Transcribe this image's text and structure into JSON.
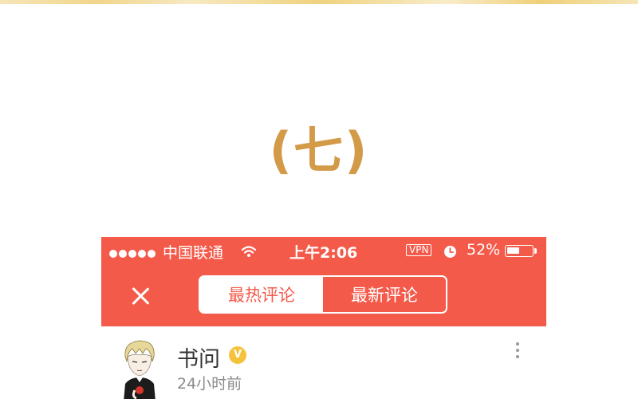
{
  "chapter": {
    "heading": "(七)"
  },
  "status_bar": {
    "carrier": "中国联通",
    "time": "上午2:06",
    "vpn": "VPN",
    "battery": "52%",
    "battery_level": 0.52,
    "signal_dots": 5
  },
  "header": {
    "tabs": [
      {
        "label": "最热评论",
        "active": true
      },
      {
        "label": "最新评论",
        "active": false
      }
    ],
    "accent_color": "#f45a4a"
  },
  "comment": {
    "username": "书问",
    "badge": "V",
    "timestamp": "24小时前"
  },
  "icons": [
    "wifi-icon",
    "alarm-icon",
    "battery-icon",
    "close-icon",
    "more-vertical-icon"
  ]
}
